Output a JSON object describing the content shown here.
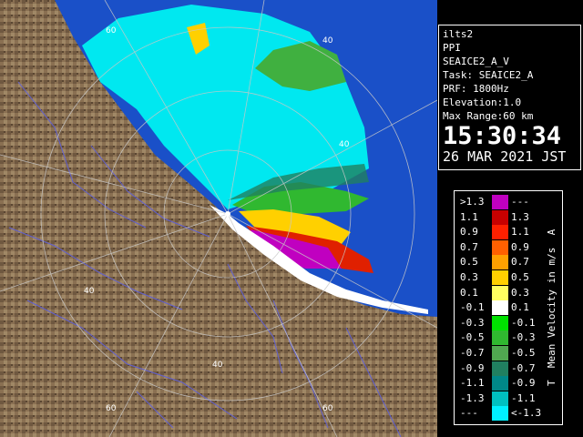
{
  "header": {
    "site": "ilts2",
    "scan_type": "PPI",
    "volume": "SEAICE2_A_V",
    "task": "Task: SEAICE2_A",
    "prf": "PRF: 1800Hz",
    "elevation": "Elevation:1.0",
    "max_range": "Max Range:60 km",
    "time": "15:30:34",
    "date": "26 MAR 2021 JST"
  },
  "range_labels": [
    "60",
    "40",
    "40",
    "40",
    "60",
    "60",
    "40",
    "40"
  ],
  "legend": {
    "unit": "Mean Velocity in m/s",
    "corner_top": "A",
    "corner_bottom": "T",
    "rows": [
      {
        "left": ">1.3",
        "right": "---",
        "color": "#c000c0"
      },
      {
        "left": "1.1",
        "right": "1.3",
        "color": "#c80000"
      },
      {
        "left": "0.9",
        "right": "1.1",
        "color": "#ff2000"
      },
      {
        "left": "0.7",
        "right": "0.9",
        "color": "#ff6000"
      },
      {
        "left": "0.5",
        "right": "0.7",
        "color": "#ffa000"
      },
      {
        "left": "0.3",
        "right": "0.5",
        "color": "#ffd000"
      },
      {
        "left": "0.1",
        "right": "0.3",
        "color": "#ffff60"
      },
      {
        "left": "-0.1",
        "right": "0.1",
        "color": "#ffffff"
      },
      {
        "left": "-0.3",
        "right": "-0.1",
        "color": "#00e000"
      },
      {
        "left": "-0.5",
        "right": "-0.3",
        "color": "#30b830"
      },
      {
        "left": "-0.7",
        "right": "-0.5",
        "color": "#50a850"
      },
      {
        "left": "-0.9",
        "right": "-0.7",
        "color": "#208060"
      },
      {
        "left": "-1.1",
        "right": "-0.9",
        "color": "#008888"
      },
      {
        "left": "-1.3",
        "right": "-1.1",
        "color": "#00c0c0"
      },
      {
        "left": "---",
        "right": "<-1.3",
        "color": "#00f0ff"
      }
    ]
  },
  "colors": {
    "sea": "#1a50c8",
    "land": "#8a7052",
    "echo_cyan": "#00e8f0",
    "echo_green": "#40b040",
    "echo_magenta": "#c000c0",
    "echo_red": "#e02000",
    "echo_yellow": "#ffd000",
    "range_ring": "#c8c8c8",
    "river": "#6060d0"
  }
}
